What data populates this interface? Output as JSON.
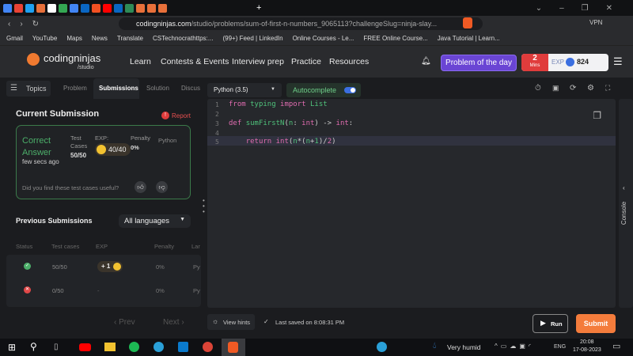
{
  "browser": {
    "url_host": "codingninjas.com",
    "url_path": "/studio/problems/sum-of-first-n-numbers_9065113?challengeSlug=ninja-slay...",
    "vpn": "VPN",
    "bookmarks": [
      "Gmail",
      "YouTube",
      "Maps",
      "News",
      "Translate",
      "CSTechnocrathttps:...",
      "(99+) Feed | LinkedIn",
      "Online Courses - Le...",
      "FREE Online Course...",
      "Java Tutorial | Learn..."
    ]
  },
  "header": {
    "logo_main": "codingninjas",
    "logo_sub": "/studio",
    "nav": [
      "Learn",
      "Contests & Events",
      "Interview prep",
      "Practice",
      "Resources"
    ],
    "potd": "Problem of the day",
    "streak_num": "2",
    "streak_unit": "Mins",
    "exp_label": "EXP",
    "exp_value": "824"
  },
  "left": {
    "topics": "Topics",
    "tabs": [
      "Problem",
      "Submissions",
      "Solution",
      "Discus"
    ],
    "current_title": "Current Submission",
    "report": "Report",
    "status": "Correct Answer",
    "time": "few secs ago",
    "test_label": "Test Cases",
    "test_value": "50/50",
    "exp_label": "EXP:",
    "exp_value": "40/40",
    "penalty_label": "Penalty",
    "penalty_value": "0%",
    "lang": "Python",
    "feedback": "Did you find these test cases useful?",
    "prev_title": "Previous Submissions",
    "filter": "All languages",
    "columns": [
      "Status",
      "Test cases",
      "EXP",
      "Penalty",
      "Lar"
    ],
    "rows": [
      {
        "status": "success",
        "tests": "50/50",
        "exp": "+ 1",
        "penalty": "0%",
        "lang": "Py"
      },
      {
        "status": "fail",
        "tests": "0/50",
        "exp": "-",
        "penalty": "0%",
        "lang": "Py"
      }
    ],
    "prev": "Prev",
    "next": "Next"
  },
  "editor": {
    "language": "Python (3.5)",
    "autocomplete": "Autocomplete",
    "line_numbers": [
      "1",
      "2",
      "3",
      "4",
      "5"
    ],
    "view_hints": "View hints",
    "last_saved": "Last saved on 8:08:31 PM",
    "run": "Run",
    "submit": "Submit",
    "console": "Console"
  },
  "taskbar": {
    "weather": "Very humid",
    "lang": "ENG",
    "time": "20:08",
    "date": "17-08-2023"
  }
}
